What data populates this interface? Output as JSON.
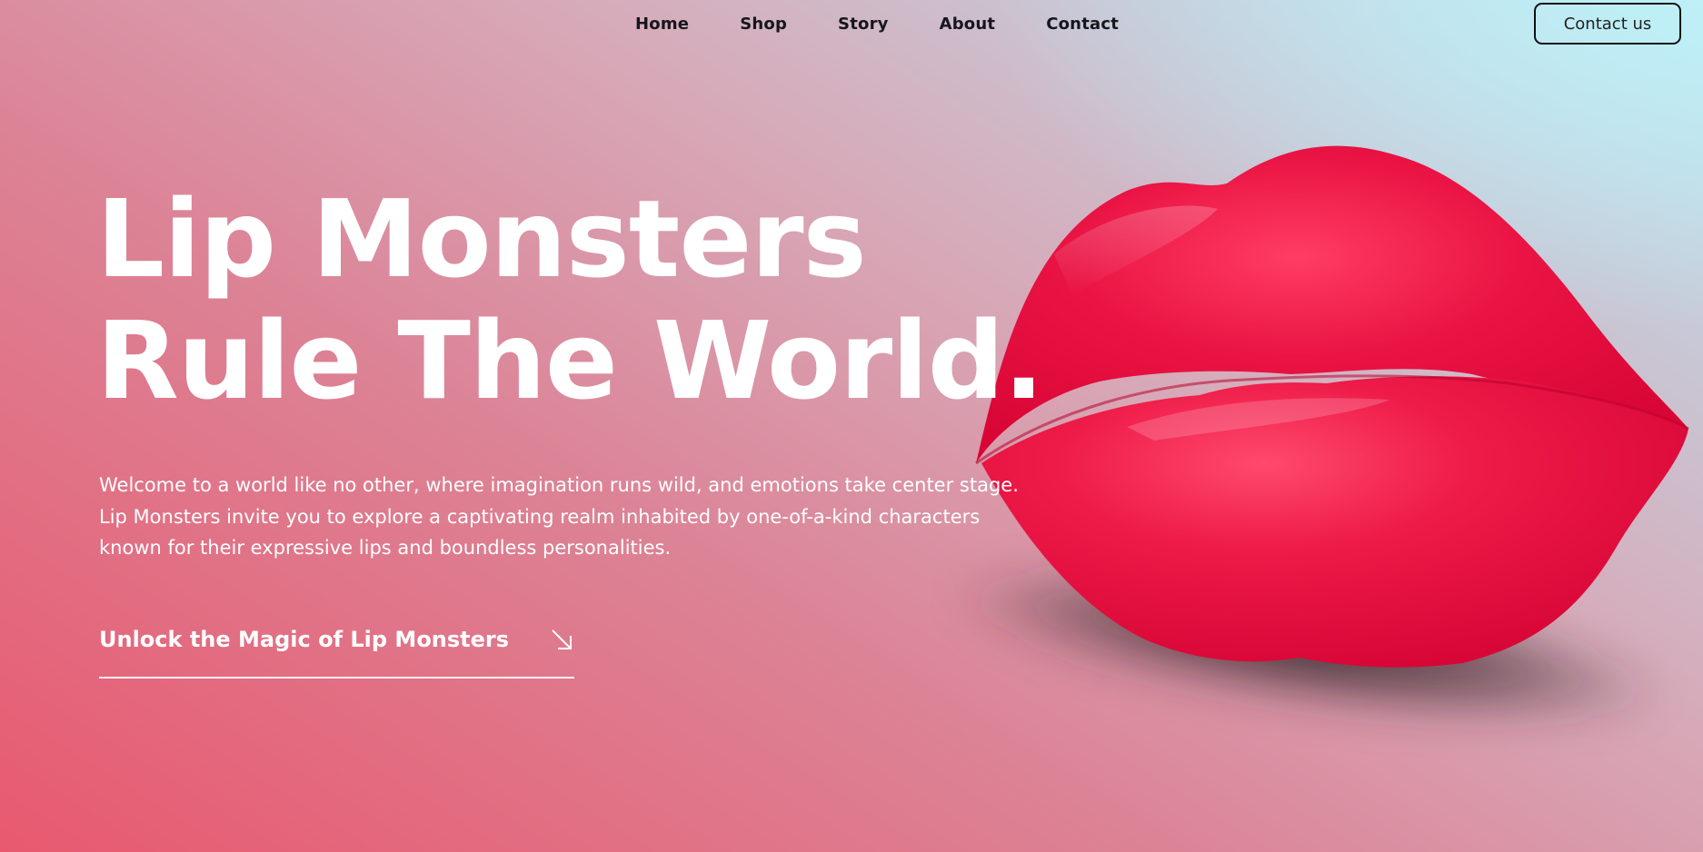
{
  "nav": {
    "items": [
      "Home",
      "Shop",
      "Story",
      "About",
      "Contact"
    ],
    "contact_button": "Contact us"
  },
  "hero": {
    "title_lines": [
      "Lip Monsters",
      "Rule The World."
    ],
    "description_lines": [
      "Welcome to a world like no other, where imagination runs wild, and emotions take center stage.",
      "Lip Monsters invite you to explore a captivating realm inhabited by one-of-a-kind characters",
      "known for their expressive lips and boundless personalities."
    ],
    "cta_label": "Unlock the Magic of Lip Monsters",
    "cta_icon": "arrow-down-right-icon"
  },
  "colors": {
    "lips": "#e8163f",
    "text_light": "#ffffff",
    "text_dark": "#16161d",
    "bg_pink": "#e8596f",
    "bg_cyan": "#bfe6ef"
  }
}
